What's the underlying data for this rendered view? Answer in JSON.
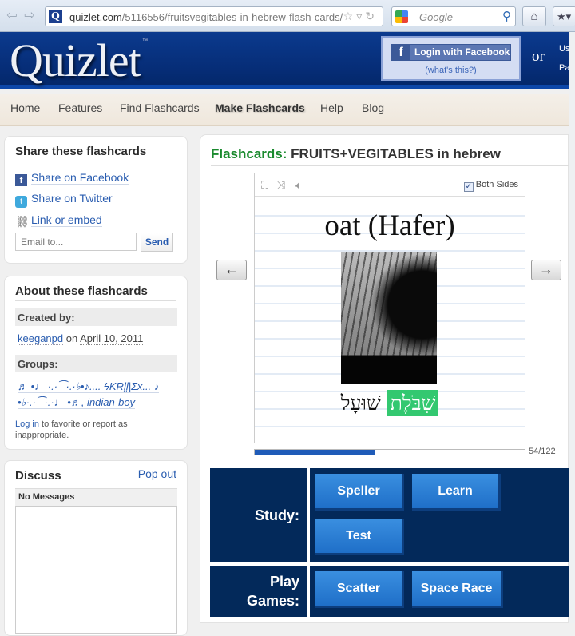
{
  "browser": {
    "url_host": "quizlet.com",
    "url_path": "/5116556/fruitsvegitables-in-hebrew-flash-cards/",
    "search_placeholder": "Google",
    "favicon_letter": "Q"
  },
  "header": {
    "logo": "Quizlet",
    "tm": "™",
    "fb_login_label": "Login with Facebook",
    "fb_whats_this": "(what's this?)",
    "or_text": "or",
    "user_cut_1": "Us",
    "user_cut_2": "Pa"
  },
  "nav": {
    "items": [
      {
        "label": "Home"
      },
      {
        "label": "Features"
      },
      {
        "label": "Find Flashcards"
      },
      {
        "label": "Make Flashcards"
      },
      {
        "label": "Help"
      },
      {
        "label": "Blog"
      }
    ]
  },
  "share": {
    "title": "Share these flashcards",
    "facebook": "Share on Facebook",
    "twitter": "Share on Twitter",
    "link": "Link or embed",
    "email_placeholder": "Email to...",
    "send": "Send"
  },
  "about": {
    "title": "About these flashcards",
    "created_by_label": "Created by:",
    "creator": "keeganpd",
    "on_word": " on ",
    "date": "April 10, 2011",
    "groups_label": "Groups:",
    "groups_line1": "♬ •♩ ·.·⁀·.·♭•♪.... ϟKRļļ|Σx... ♪",
    "groups_line2": "•♭·.·⁀·.·♩ •♬, indian-boy",
    "login_link": "Log in",
    "login_rest": " to favorite or report as inappropriate."
  },
  "discuss": {
    "title": "Discuss",
    "popout": "Pop out",
    "no_messages": "No Messages"
  },
  "main": {
    "title_prefix": "Flashcards:",
    "title": " FRUITS+VEGITABLES in hebrew",
    "both_sides": "Both Sides",
    "both_sides_checked": true,
    "term": "oat (Hafer)",
    "def_highlight": "שִׁבֹּלֶת",
    "def_rest": " שׁוּעָל",
    "prev_arrow": "←",
    "next_arrow": "→",
    "progress_current": 54,
    "progress_total": 122,
    "progress_label": "54/122"
  },
  "modes": {
    "study_label": "Study:",
    "play_label_1": "Play",
    "play_label_2": "Games:",
    "study_buttons": [
      "Speller",
      "Learn",
      "Test"
    ],
    "game_buttons": [
      "Scatter",
      "Space Race"
    ]
  },
  "colors": {
    "brand_blue": "#062d77",
    "mode_bg": "#03295a",
    "mode_button": "#2a7fd8",
    "title_green": "#1a8a2e",
    "highlight_green": "#33c870",
    "progress_blue": "#1f5bb8"
  }
}
